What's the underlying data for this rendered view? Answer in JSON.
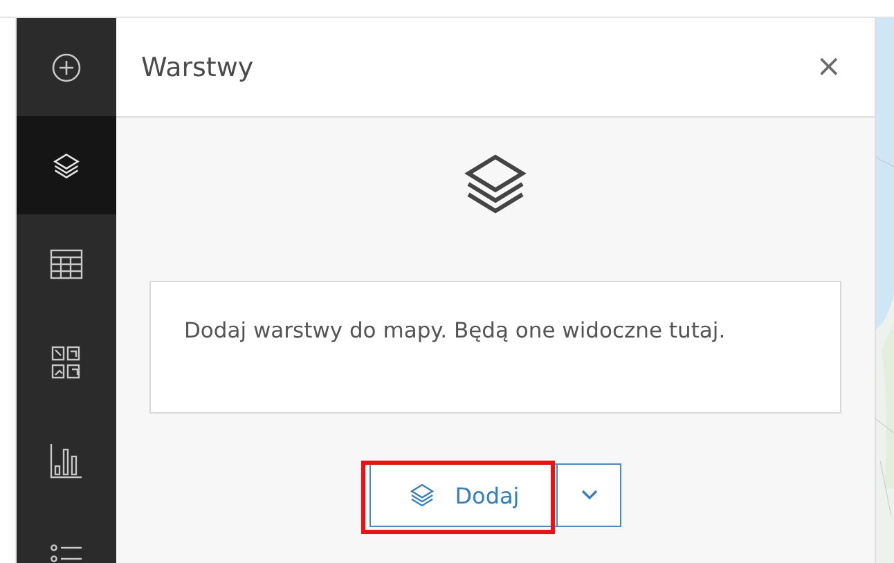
{
  "sidebar": {
    "items": [
      {
        "kind": "add",
        "selected": false
      },
      {
        "kind": "layers",
        "selected": true
      },
      {
        "kind": "table",
        "selected": false
      },
      {
        "kind": "widgets",
        "selected": false
      },
      {
        "kind": "chart",
        "selected": false
      },
      {
        "kind": "list",
        "selected": false
      }
    ]
  },
  "panel": {
    "title": "Warstwy",
    "close": "×",
    "message": "Dodaj warstwy do mapy. Będą one widoczne tutaj.",
    "add_button": {
      "label": "Dodaj",
      "highlighted": true
    }
  }
}
